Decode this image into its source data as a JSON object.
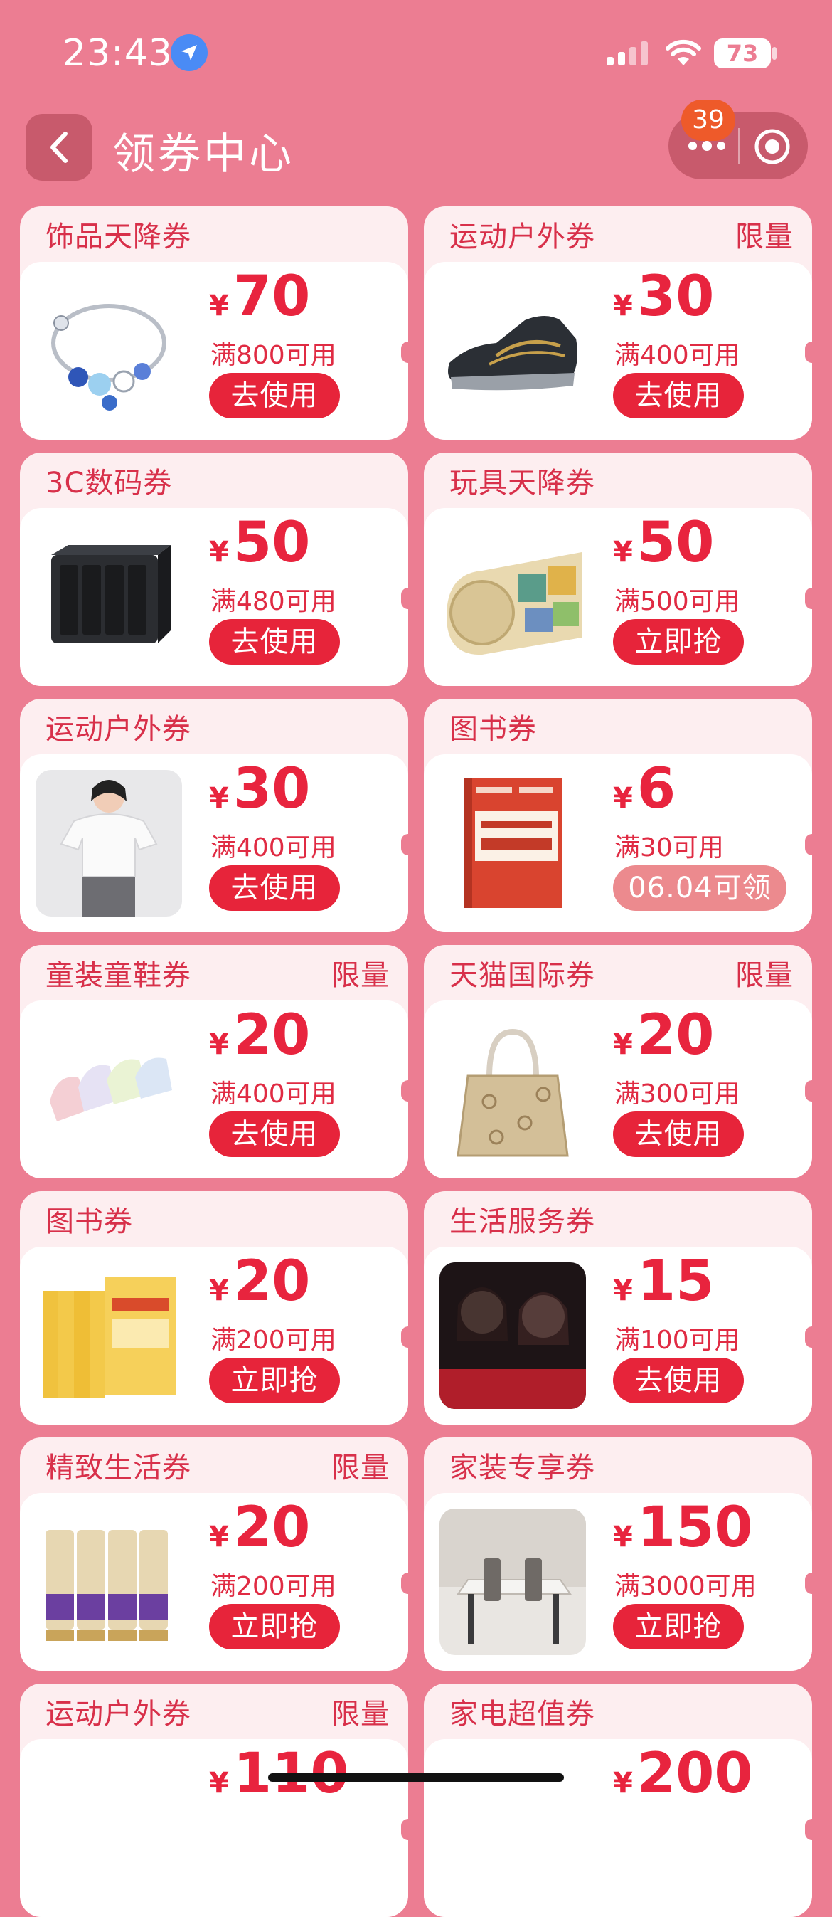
{
  "status_bar": {
    "time": "23:43",
    "battery": "73"
  },
  "nav": {
    "title": "领券中心",
    "badge_count": "39"
  },
  "colors": {
    "background": "#ec7d92",
    "accent": "#e7243a",
    "pending": "#ec8a8e"
  },
  "currency": "¥",
  "coupons": [
    {
      "title": "饰品天降券",
      "tag": "",
      "amount": "70",
      "condition": "满800可用",
      "button": "去使用",
      "image": "bracelet"
    },
    {
      "title": "运动户外券",
      "tag": "限量",
      "amount": "30",
      "condition": "满400可用",
      "button": "去使用",
      "image": "sneaker"
    },
    {
      "title": "3C数码券",
      "tag": "",
      "amount": "50",
      "condition": "满480可用",
      "button": "去使用",
      "image": "nas-device"
    },
    {
      "title": "玩具天降券",
      "tag": "",
      "amount": "50",
      "condition": "满500可用",
      "button": "立即抢",
      "image": "play-mat"
    },
    {
      "title": "运动户外券",
      "tag": "",
      "amount": "30",
      "condition": "满400可用",
      "button": "去使用",
      "image": "tshirt-model"
    },
    {
      "title": "图书券",
      "tag": "",
      "amount": "6",
      "condition": "满30可用",
      "button": "06.04可领",
      "image": "math-book"
    },
    {
      "title": "童装童鞋券",
      "tag": "限量",
      "amount": "20",
      "condition": "满400可用",
      "button": "去使用",
      "image": "kids-jackets"
    },
    {
      "title": "天猫国际券",
      "tag": "限量",
      "amount": "20",
      "condition": "满300可用",
      "button": "去使用",
      "image": "tote-bag"
    },
    {
      "title": "图书券",
      "tag": "",
      "amount": "20",
      "condition": "满200可用",
      "button": "立即抢",
      "image": "book-set"
    },
    {
      "title": "生活服务券",
      "tag": "",
      "amount": "15",
      "condition": "满100可用",
      "button": "去使用",
      "image": "beauty-photo"
    },
    {
      "title": "精致生活券",
      "tag": "限量",
      "amount": "20",
      "condition": "满200可用",
      "button": "立即抢",
      "image": "conditioner"
    },
    {
      "title": "家装专享券",
      "tag": "",
      "amount": "150",
      "condition": "满3000可用",
      "button": "立即抢",
      "image": "dining-set"
    },
    {
      "title": "运动户外券",
      "tag": "限量",
      "amount": "110",
      "condition": "",
      "button": "",
      "image": ""
    },
    {
      "title": "家电超值券",
      "tag": "",
      "amount": "200",
      "condition": "",
      "button": "",
      "image": ""
    }
  ]
}
